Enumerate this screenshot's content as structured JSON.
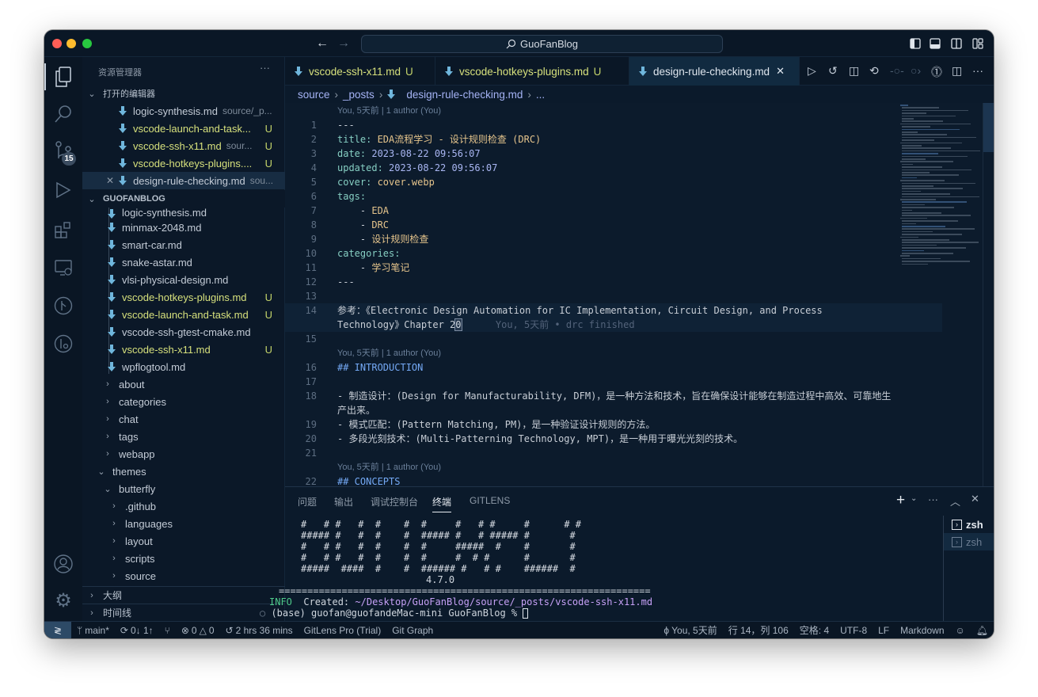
{
  "window": {
    "title": "GuoFanBlog",
    "traffic_lights": [
      "#ff5f57",
      "#febc2e",
      "#28c840"
    ]
  },
  "colors": {
    "background": "#0b1a2b",
    "modified": "#d6e07c",
    "markdown_icon": "#6fb6dc",
    "key": "#86cfc3",
    "string": "#e5c48c",
    "date": "#a9b6f2",
    "heading": "#74a9f5"
  },
  "activity_bar": {
    "items": [
      "explorer-icon",
      "search-icon",
      "source-control-icon",
      "run-debug-icon",
      "extensions-icon",
      "remote-explorer-icon",
      "git-graph-icon",
      "gitlens-icon"
    ],
    "scm_badge": "15",
    "bottom": [
      "account-icon",
      "settings-gear-icon"
    ]
  },
  "sidebar": {
    "title": "资源管理器",
    "more": "···",
    "open_editors_label": "打开的编辑器",
    "open_editors": [
      {
        "name": "logic-synthesis.md",
        "desc": "source/_p...",
        "status": "",
        "modified": false
      },
      {
        "name": "vscode-launch-and-task...",
        "desc": "",
        "status": "U",
        "modified": true
      },
      {
        "name": "vscode-ssh-x11.md",
        "desc": "sour...",
        "status": "U",
        "modified": true
      },
      {
        "name": "vscode-hotkeys-plugins....",
        "desc": "",
        "status": "U",
        "modified": true
      },
      {
        "name": "design-rule-checking.md",
        "desc": "sou...",
        "status": "",
        "modified": false,
        "active": true
      }
    ],
    "project_label": "GUOFANBLOG",
    "files": [
      {
        "name": "logic-synthesis.md",
        "status": "",
        "modified": false
      },
      {
        "name": "minmax-2048.md",
        "status": "",
        "modified": false
      },
      {
        "name": "smart-car.md",
        "status": "",
        "modified": false
      },
      {
        "name": "snake-astar.md",
        "status": "",
        "modified": false
      },
      {
        "name": "vlsi-physical-design.md",
        "status": "",
        "modified": false
      },
      {
        "name": "vscode-hotkeys-plugins.md",
        "status": "U",
        "modified": true
      },
      {
        "name": "vscode-launch-and-task.md",
        "status": "U",
        "modified": true
      },
      {
        "name": "vscode-ssh-gtest-cmake.md",
        "status": "",
        "modified": false
      },
      {
        "name": "vscode-ssh-x11.md",
        "status": "U",
        "modified": true
      },
      {
        "name": "wpflogtool.md",
        "status": "",
        "modified": false
      }
    ],
    "folders": [
      {
        "name": "about",
        "depth": 2,
        "expanded": false
      },
      {
        "name": "categories",
        "depth": 2,
        "expanded": false
      },
      {
        "name": "chat",
        "depth": 2,
        "expanded": false
      },
      {
        "name": "tags",
        "depth": 2,
        "expanded": false
      },
      {
        "name": "webapp",
        "depth": 2,
        "expanded": false
      },
      {
        "name": "themes",
        "depth": 1,
        "expanded": true
      },
      {
        "name": "butterfly",
        "depth": 2,
        "expanded": true
      },
      {
        "name": ".github",
        "depth": 3,
        "expanded": false
      },
      {
        "name": "languages",
        "depth": 3,
        "expanded": false
      },
      {
        "name": "layout",
        "depth": 3,
        "expanded": false
      },
      {
        "name": "scripts",
        "depth": 3,
        "expanded": false
      },
      {
        "name": "source",
        "depth": 3,
        "expanded": false
      }
    ],
    "outline_label": "大纲",
    "timeline_label": "时间线"
  },
  "tabs": [
    {
      "label": "vscode-ssh-x11.md",
      "status": "U",
      "modified": true
    },
    {
      "label": "vscode-hotkeys-plugins.md",
      "status": "U",
      "modified": true
    },
    {
      "label": "design-rule-checking.md",
      "status": "",
      "modified": false,
      "active": true,
      "close": "✕"
    }
  ],
  "editor_actions": [
    "run-icon",
    "history-icon",
    "open-preview-icon",
    "previous-change-icon",
    "commit-icon",
    "next-change-icon",
    "gitlens-inspect-icon",
    "split-editor-icon",
    "more-icon"
  ],
  "breadcrumb": [
    "source",
    "_posts",
    "design-rule-checking.md",
    "..."
  ],
  "editor": {
    "lines": [
      {
        "lens": "You, 5天前 | 1 author (You)"
      },
      {
        "n": "1",
        "segs": [
          [
            "---",
            "p"
          ]
        ]
      },
      {
        "n": "2",
        "segs": [
          [
            "title: ",
            "k"
          ],
          [
            "EDA流程学习 - 设计规则检查 (DRC)",
            "s"
          ]
        ]
      },
      {
        "n": "3",
        "segs": [
          [
            "date: ",
            "k"
          ],
          [
            "2023-08-22 09:56:07",
            "n"
          ]
        ]
      },
      {
        "n": "4",
        "segs": [
          [
            "updated: ",
            "k"
          ],
          [
            "2023-08-22 09:56:07",
            "n"
          ]
        ]
      },
      {
        "n": "5",
        "segs": [
          [
            "cover: ",
            "k"
          ],
          [
            "cover.webp",
            "s"
          ]
        ]
      },
      {
        "n": "6",
        "segs": [
          [
            "tags:",
            "k"
          ]
        ]
      },
      {
        "n": "7",
        "segs": [
          [
            "    - ",
            "p"
          ],
          [
            "EDA",
            "s"
          ]
        ]
      },
      {
        "n": "8",
        "segs": [
          [
            "    - ",
            "p"
          ],
          [
            "DRC",
            "s"
          ]
        ]
      },
      {
        "n": "9",
        "segs": [
          [
            "    - ",
            "p"
          ],
          [
            "设计规则检查",
            "s"
          ]
        ]
      },
      {
        "n": "10",
        "segs": [
          [
            "categories:",
            "k"
          ]
        ]
      },
      {
        "n": "11",
        "segs": [
          [
            "    - ",
            "p"
          ],
          [
            "学习笔记",
            "s"
          ]
        ]
      },
      {
        "n": "12",
        "segs": [
          [
            "---",
            "p"
          ]
        ]
      },
      {
        "n": "13",
        "segs": []
      },
      {
        "n": "14",
        "current": true,
        "segs": [
          [
            "参考：《Electronic Design Automation for IC Implementation, Circuit Design, and Process",
            "p"
          ]
        ]
      },
      {
        "n": "",
        "current": true,
        "segs": [
          [
            "Technology》Chapter 2",
            "p"
          ],
          [
            "0",
            "cur"
          ],
          [
            "      You, 5天前 • drc finished",
            "b"
          ]
        ]
      },
      {
        "n": "15",
        "segs": []
      },
      {
        "lens": "You, 5天前 | 1 author (You)"
      },
      {
        "n": "16",
        "segs": [
          [
            "## INTRODUCTION",
            "h"
          ]
        ]
      },
      {
        "n": "17",
        "segs": []
      },
      {
        "n": "18",
        "segs": [
          [
            "- 制造设计：(Design for Manufacturability, DFM)，是一种方法和技术，旨在确保设计能够在制造过程中高效、可靠地生",
            "p"
          ]
        ]
      },
      {
        "n": "",
        "segs": [
          [
            "产出来。",
            "p"
          ]
        ]
      },
      {
        "n": "19",
        "segs": [
          [
            "- 模式匹配：(Pattern Matching, PM)，是一种验证设计规则的方法。",
            "p"
          ]
        ]
      },
      {
        "n": "20",
        "segs": [
          [
            "- 多段光刻技术：(Multi-Patterning Technology, MPT)，是一种用于曝光光刻的技术。",
            "p"
          ]
        ]
      },
      {
        "n": "21",
        "segs": []
      },
      {
        "lens": "You, 5天前 | 1 author (You)"
      },
      {
        "n": "22",
        "segs": [
          [
            "## CONCEPTS",
            "h"
          ]
        ]
      },
      {
        "n": "23",
        "segs": []
      }
    ]
  },
  "panel": {
    "tabs": [
      {
        "label": "问题"
      },
      {
        "label": "输出"
      },
      {
        "label": "调试控制台"
      },
      {
        "label": "终端",
        "active": true
      },
      {
        "label": "GITLENS"
      }
    ],
    "terminal": {
      "banner": [
        "#   # #   #  #    #  #     #   # #     #      # #",
        "##### #   #  #    #  ##### #   # ##### #       #",
        "#   # #   #  #    #  #     #####  #    #       #",
        "#   # #   #  #    #  #     #  # #      #       #",
        "#####  ####  #    #  ###### #   # #    ######  #"
      ],
      "version": "4.7.0",
      "separator": "=================================================================",
      "info_label": "INFO",
      "info_text": "Created: ",
      "info_path": "~/Desktop/GuoFanBlog/source/_posts/vscode-ssh-x11.md",
      "prompt": "(base) guofan@guofandeMac-mini GuoFanBlog % "
    },
    "terminals": [
      {
        "label": "zsh"
      },
      {
        "label": "zsh",
        "selected": true
      }
    ]
  },
  "status_bar": {
    "branch": "main*",
    "sync": "0↓ 1↑",
    "errors": "0",
    "warnings": "0",
    "time": "2 hrs 36 mins",
    "gitlens": "GitLens Pro (Trial)",
    "git_graph": "Git Graph",
    "blame": "You, 5天前",
    "position": "行 14，列 106",
    "indent": "空格: 4",
    "encoding": "UTF-8",
    "eol": "LF",
    "language": "Markdown"
  }
}
